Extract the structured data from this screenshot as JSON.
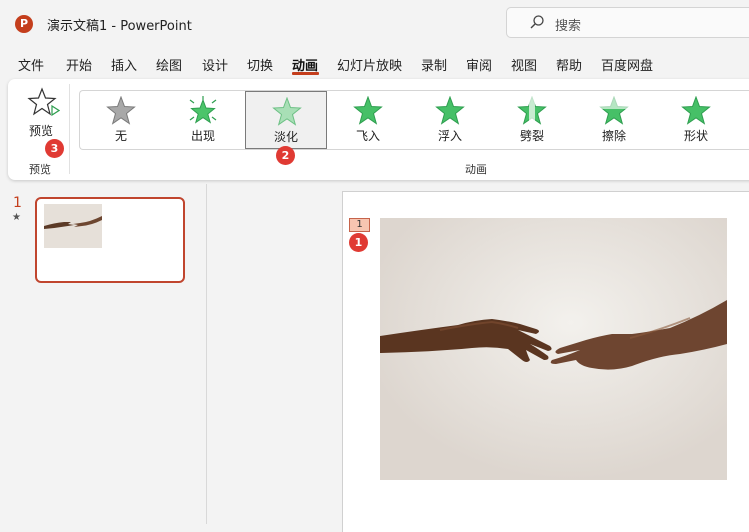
{
  "titlebar": {
    "app_icon_letter": "P",
    "doc_title": "演示文稿1  -  PowerPoint",
    "search_placeholder": "搜索"
  },
  "menu": {
    "items": [
      "文件",
      "开始",
      "插入",
      "绘图",
      "设计",
      "切换",
      "动画",
      "幻灯片放映",
      "录制",
      "审阅",
      "视图",
      "帮助",
      "百度网盘"
    ],
    "active": "动画"
  },
  "ribbon": {
    "preview": {
      "button_label": "预览",
      "group_label": "预览"
    },
    "animation_group_label": "动画",
    "animations": [
      {
        "label": "无",
        "icon": "star-gray-icon"
      },
      {
        "label": "出现",
        "icon": "star-burst-green-icon"
      },
      {
        "label": "淡化",
        "icon": "star-fade-green-icon",
        "selected": true
      },
      {
        "label": "飞入",
        "icon": "star-fly-in-green-icon"
      },
      {
        "label": "浮入",
        "icon": "star-float-in-green-icon"
      },
      {
        "label": "劈裂",
        "icon": "star-split-green-icon"
      },
      {
        "label": "擦除",
        "icon": "star-wipe-green-icon"
      },
      {
        "label": "形状",
        "icon": "star-shape-green-icon"
      }
    ]
  },
  "badges": {
    "preview": "3",
    "fade": "2",
    "slide_anim": "1"
  },
  "slides": {
    "current_number": "1",
    "has_animation_marker": "★",
    "animation_tag": "1"
  },
  "colors": {
    "accent": "#c43e1c",
    "badge": "#e03a33",
    "star_green": "#3cb35b",
    "star_gray": "#9a9a9a"
  }
}
